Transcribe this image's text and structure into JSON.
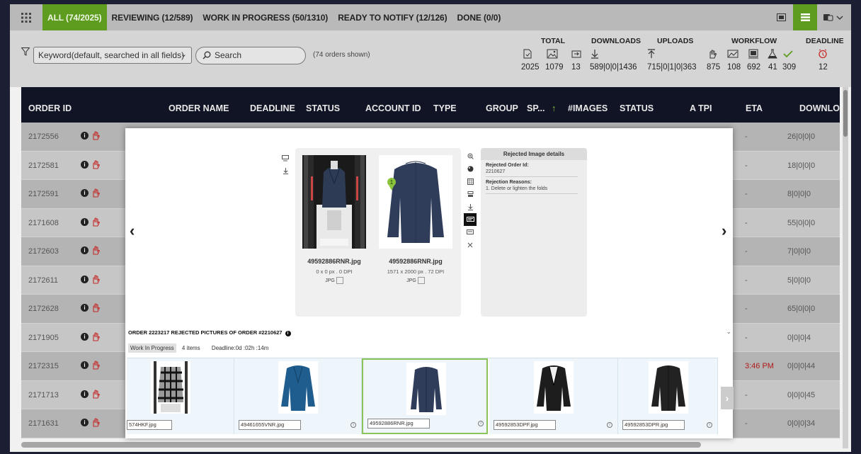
{
  "tabs": [
    {
      "label": "ALL (74/2025)",
      "active": true
    },
    {
      "label": "REVIEWING (12/589)"
    },
    {
      "label": "WORK IN PROGRESS (50/1310)"
    },
    {
      "label": "READY TO NOTIFY (12/126)"
    },
    {
      "label": "DONE (0/0)"
    }
  ],
  "filter": {
    "keyword_select": "Keyword(default, searched in all fields)",
    "search_placeholder": "Search",
    "orders_shown": "(74 orders shown)"
  },
  "stats": {
    "total_label": "TOTAL",
    "downloads_label": "DOWNLOADS",
    "uploads_label": "UPLOADS",
    "workflow_label": "WORKFLOW",
    "deadline_label": "DEADLINE",
    "values": [
      "2025",
      "1079",
      "13",
      "589|0|0|1436",
      "715|0|1|0|363",
      "875",
      "108",
      "692",
      "41",
      "309",
      "12"
    ]
  },
  "table": {
    "headers": [
      "ORDER ID",
      "ORDER NAME",
      "DEADLINE",
      "STATUS",
      "ACCOUNT ID",
      "TYPE",
      "GROUP",
      "SP...",
      "#IMAGES",
      "STATUS",
      "A TPI",
      "ETA",
      "DOWNLO"
    ],
    "rows": [
      {
        "id": "2172556",
        "eta": "-",
        "dl": "26|0|0|0"
      },
      {
        "id": "2172581",
        "eta": "-",
        "dl": "18|0|0|0"
      },
      {
        "id": "2172591",
        "eta": "-",
        "dl": "8|0|0|0"
      },
      {
        "id": "2171608",
        "eta": "-",
        "dl": "55|0|0|0"
      },
      {
        "id": "2172603",
        "eta": "-",
        "dl": "7|0|0|0"
      },
      {
        "id": "2172611",
        "eta": "-",
        "dl": "5|0|0|0"
      },
      {
        "id": "2172628",
        "eta": "-",
        "dl": "65|0|0|0"
      },
      {
        "id": "2171905",
        "eta": "-",
        "dl": "0|0|0|4"
      },
      {
        "id": "2172315",
        "eta": "3:46 PM",
        "eta_red": true,
        "dl": "0|0|0|44"
      },
      {
        "id": "2171713",
        "eta": "-",
        "dl": "0|0|0|45"
      },
      {
        "id": "2171631",
        "eta": "-",
        "dl": "0|0|0|34"
      }
    ]
  },
  "modal": {
    "viewer_images": [
      {
        "name": "49592886RNR.jpg",
        "meta": "0 x 0 px . 0 DPI",
        "type": "JPG"
      },
      {
        "name": "49592886RNR.jpg",
        "meta": "1571 x 2000 px . 72 DPI",
        "type": "JPG",
        "pin": "1"
      }
    ],
    "reject_panel": {
      "title": "Rejected Image details",
      "order_id_label": "Rejected Order Id:",
      "order_id": "2210627",
      "reasons_label": "Rejection Reasons:",
      "reason": "1. Delete or lighten the folds"
    },
    "order_title": "ORDER 2223217   REJECTED PICTURES OF ORDER #2210627",
    "status_pill": "Work In Progress",
    "items": "4 items",
    "deadline": "Deadline:0d :02h :14m",
    "thumbs": [
      {
        "file": "574HKF.jpg",
        "style": "plaid"
      },
      {
        "file": "49461655VNR.jpg",
        "style": "blue"
      },
      {
        "file": "49592886RNR.jpg",
        "style": "navy",
        "selected": true
      },
      {
        "file": "49592853DPF.jpg",
        "style": "black"
      },
      {
        "file": "49592853DPR.jpg",
        "style": "black-back"
      }
    ]
  },
  "colors": {
    "accent": "#5e9c1f",
    "header_bg": "#111425",
    "eta_red": "#b11a1a"
  }
}
